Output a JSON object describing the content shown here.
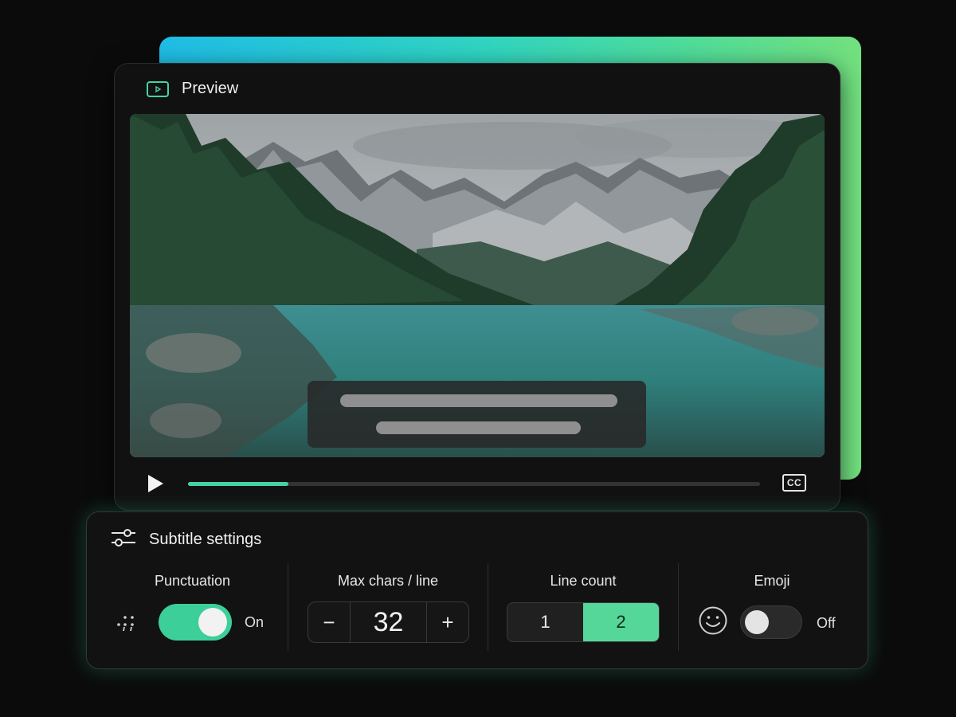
{
  "preview": {
    "title": "Preview",
    "progress_fraction": 0.175,
    "subtitle_placeholder_lines": 2,
    "cc_label": "CC"
  },
  "settings": {
    "title": "Subtitle settings",
    "punctuation": {
      "label": "Punctuation",
      "enabled": true,
      "state": "On"
    },
    "max_chars": {
      "label": "Max chars / line",
      "value": "32",
      "decrement": "−",
      "increment": "+"
    },
    "line_count": {
      "label": "Line count",
      "options": [
        "1",
        "2"
      ],
      "selected": "2"
    },
    "emoji": {
      "label": "Emoji",
      "enabled": false,
      "state": "Off"
    }
  },
  "colors": {
    "accent": "#43d3a6",
    "toggle_on": "#3ccf9a",
    "segment_active": "#56d79a",
    "backdrop_start": "#1fbde6",
    "backdrop_end": "#73e07e"
  },
  "icons": [
    "play-box-icon",
    "play-icon",
    "cc-icon",
    "sliders-icon",
    "punctuation-icon",
    "smiley-icon"
  ]
}
